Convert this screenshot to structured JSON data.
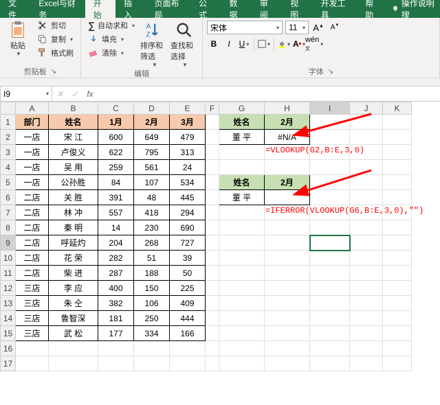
{
  "tabs": {
    "file": "文件",
    "custom": "Excel与财务",
    "home": "开始",
    "insert": "插入",
    "layout": "页面布局",
    "formulas": "公式",
    "data": "数据",
    "review": "审阅",
    "view": "视图",
    "dev": "开发工具",
    "help": "帮助",
    "tellme": "操作说明搜"
  },
  "ribbon": {
    "clipboard": {
      "paste": "粘贴",
      "cut": "剪切",
      "copy": "复制",
      "format_painter": "格式刷",
      "group": "剪贴板"
    },
    "editing": {
      "autosum": "自动求和",
      "fill": "填充",
      "clear": "清除",
      "sort": "排序和筛选",
      "find": "查找和选择",
      "group": "编辑"
    },
    "font": {
      "name": "宋体",
      "size": "11",
      "group": "字体"
    }
  },
  "namebox": "I9",
  "formula": "",
  "columns": [
    "A",
    "B",
    "C",
    "D",
    "E",
    "F",
    "G",
    "H",
    "I",
    "J",
    "K"
  ],
  "rows": 17,
  "headers": {
    "dept": "部门",
    "name": "姓名",
    "m1": "1月",
    "m2": "2月",
    "m3": "3月"
  },
  "table": [
    [
      "一店",
      "宋  江",
      "600",
      "649",
      "479"
    ],
    [
      "一店",
      "卢俊义",
      "622",
      "795",
      "313"
    ],
    [
      "一店",
      "吴  用",
      "259",
      "561",
      "24"
    ],
    [
      "一店",
      "公孙胜",
      "84",
      "107",
      "534"
    ],
    [
      "二店",
      "关  胜",
      "391",
      "48",
      "445"
    ],
    [
      "二店",
      "林  冲",
      "557",
      "418",
      "294"
    ],
    [
      "二店",
      "秦  明",
      "14",
      "230",
      "690"
    ],
    [
      "二店",
      "呼延灼",
      "204",
      "268",
      "727"
    ],
    [
      "二店",
      "花  荣",
      "282",
      "51",
      "39"
    ],
    [
      "二店",
      "柴  进",
      "287",
      "188",
      "50"
    ],
    [
      "三店",
      "李  应",
      "400",
      "150",
      "225"
    ],
    [
      "三店",
      "朱  仝",
      "382",
      "106",
      "409"
    ],
    [
      "三店",
      "鲁智深",
      "181",
      "250",
      "444"
    ],
    [
      "三店",
      "武  松",
      "177",
      "334",
      "166"
    ]
  ],
  "lookup1": {
    "h_name": "姓名",
    "h_month": "2月",
    "name": "董  平",
    "result": "#N/A"
  },
  "lookup2": {
    "h_name": "姓名",
    "h_month": "2月",
    "name": "董  平",
    "result": ""
  },
  "annot1": "=VLOOKUP(G2,B:E,3,0)",
  "annot2": "=IFERROR(VLOOKUP(G6,B:E,3,0),\"\")",
  "chart_data": {
    "type": "table",
    "title": "",
    "columns": [
      "部门",
      "姓名",
      "1月",
      "2月",
      "3月"
    ],
    "rows": [
      [
        "一店",
        "宋江",
        600,
        649,
        479
      ],
      [
        "一店",
        "卢俊义",
        622,
        795,
        313
      ],
      [
        "一店",
        "吴用",
        259,
        561,
        24
      ],
      [
        "一店",
        "公孙胜",
        84,
        107,
        534
      ],
      [
        "二店",
        "关胜",
        391,
        48,
        445
      ],
      [
        "二店",
        "林冲",
        557,
        418,
        294
      ],
      [
        "二店",
        "秦明",
        14,
        230,
        690
      ],
      [
        "二店",
        "呼延灼",
        204,
        268,
        727
      ],
      [
        "二店",
        "花荣",
        282,
        51,
        39
      ],
      [
        "二店",
        "柴进",
        287,
        188,
        50
      ],
      [
        "三店",
        "李应",
        400,
        150,
        225
      ],
      [
        "三店",
        "朱仝",
        382,
        106,
        409
      ],
      [
        "三店",
        "鲁智深",
        181,
        250,
        444
      ],
      [
        "三店",
        "武松",
        177,
        334,
        166
      ]
    ]
  }
}
